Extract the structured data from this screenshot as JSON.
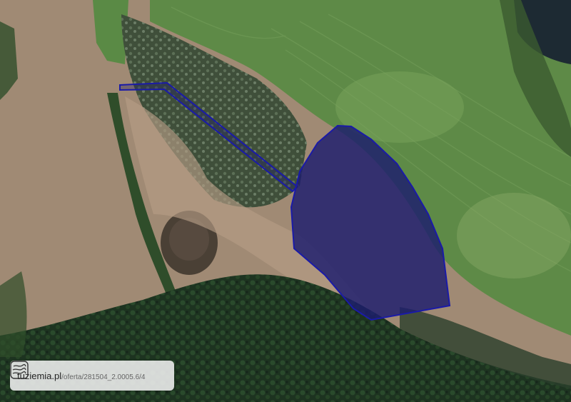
{
  "map": {
    "basemap": "satellite",
    "parcel": {
      "outline_color": "#1a1aa8",
      "fill_color": "#1c1c6e"
    }
  },
  "watermark": {
    "domain": "tuziemia.pl",
    "path": "/oferta/281504_2.0005.6/4",
    "logo_icon": "topographic-map-icon"
  }
}
